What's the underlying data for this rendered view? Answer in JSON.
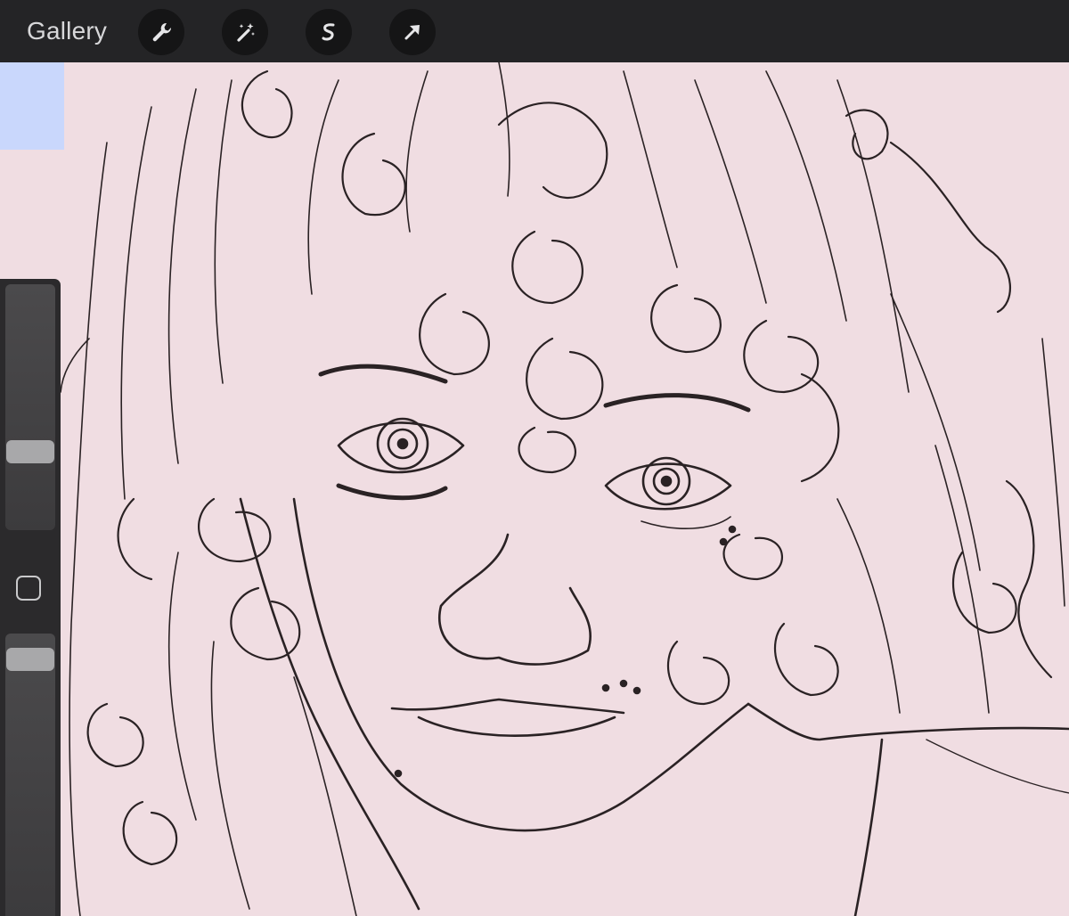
{
  "toolbar": {
    "gallery_label": "Gallery",
    "buttons": [
      {
        "name": "actions",
        "icon": "wrench-icon"
      },
      {
        "name": "adjustments",
        "icon": "magic-wand-icon"
      },
      {
        "name": "selection",
        "icon": "selection-s-icon"
      },
      {
        "name": "transform",
        "icon": "transform-arrow-icon"
      }
    ]
  },
  "sidebar": {
    "brush_size_level": 0.3,
    "opacity_level": 1.0,
    "modifier_icon": "square-modifier-icon"
  },
  "colors": {
    "canvas": "#f0dde2",
    "toolbar": "#242426",
    "sidebar": "#2b2a2c",
    "selection_chip": "#c9d7fc",
    "ink": "#2a2224"
  }
}
